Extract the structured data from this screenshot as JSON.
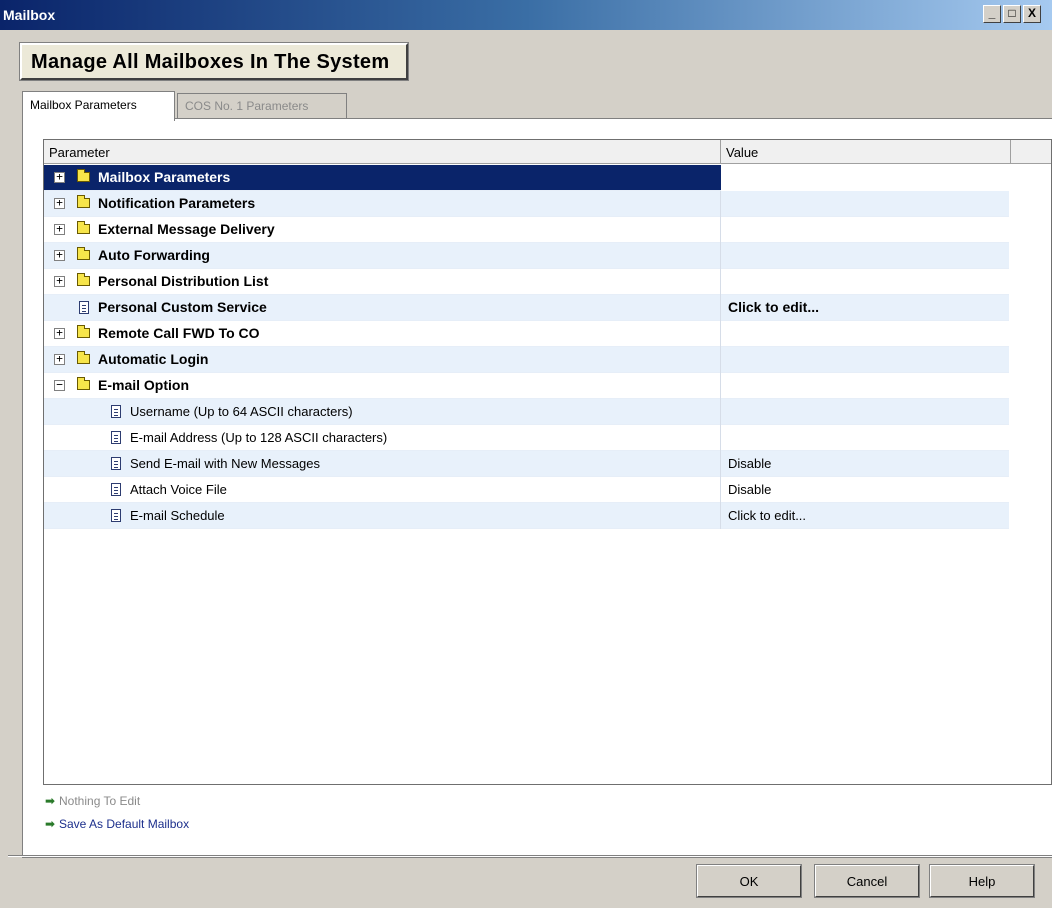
{
  "window": {
    "title": "Mailbox",
    "controls": {
      "minimize": "_",
      "maximize": "□",
      "close": "X"
    }
  },
  "header": {
    "title": "Manage All Mailboxes In The System"
  },
  "tabs": [
    {
      "label": "Mailbox Parameters",
      "active": true
    },
    {
      "label": "COS No. 1 Parameters",
      "active": false
    }
  ],
  "tree": {
    "columns": {
      "parameter": "Parameter",
      "value": "Value"
    },
    "rows": [
      {
        "label": "Mailbox Parameters",
        "value": "",
        "type": "folder",
        "expander": "+",
        "bold": true,
        "selected": true,
        "level": 0
      },
      {
        "label": "Notification Parameters",
        "value": "",
        "type": "folder",
        "expander": "+",
        "bold": true,
        "level": 0
      },
      {
        "label": "External Message Delivery",
        "value": "",
        "type": "folder",
        "expander": "+",
        "bold": true,
        "level": 0
      },
      {
        "label": "Auto Forwarding",
        "value": "",
        "type": "folder",
        "expander": "+",
        "bold": true,
        "level": 0
      },
      {
        "label": "Personal Distribution List",
        "value": "",
        "type": "folder",
        "expander": "+",
        "bold": true,
        "level": 0
      },
      {
        "label": "Personal Custom Service",
        "value": "Click to edit...",
        "type": "item",
        "expander": "",
        "bold": true,
        "level": 0
      },
      {
        "label": "Remote Call FWD To CO",
        "value": "",
        "type": "folder",
        "expander": "+",
        "bold": true,
        "level": 0
      },
      {
        "label": "Automatic Login",
        "value": "",
        "type": "folder",
        "expander": "+",
        "bold": true,
        "level": 0
      },
      {
        "label": "E-mail Option",
        "value": "",
        "type": "folder",
        "expander": "−",
        "bold": true,
        "level": 0
      },
      {
        "label": "Username (Up to 64 ASCII characters)",
        "value": "",
        "type": "item",
        "expander": "",
        "bold": false,
        "level": 1
      },
      {
        "label": "E-mail Address (Up to 128 ASCII characters)",
        "value": "",
        "type": "item",
        "expander": "",
        "bold": false,
        "level": 1
      },
      {
        "label": "Send E-mail with New Messages",
        "value": "Disable",
        "type": "item",
        "expander": "",
        "bold": false,
        "level": 1
      },
      {
        "label": "Attach Voice File",
        "value": "Disable",
        "type": "item",
        "expander": "",
        "bold": false,
        "level": 1
      },
      {
        "label": "E-mail Schedule",
        "value": "Click to edit...",
        "type": "item",
        "expander": "",
        "bold": false,
        "level": 1
      }
    ]
  },
  "links": {
    "nothing_to_edit": "Nothing To Edit",
    "save_default": "Save As Default Mailbox"
  },
  "buttons": {
    "ok": "OK",
    "cancel": "Cancel",
    "help": "Help"
  },
  "colors": {
    "selection": "#0a246a",
    "stripe": "#e8f1fb",
    "folder": "#f7e54a",
    "link_arrow": "#2a7a2a",
    "disabled_text": "#8a8a8a",
    "link_text": "#1c2f8c"
  }
}
